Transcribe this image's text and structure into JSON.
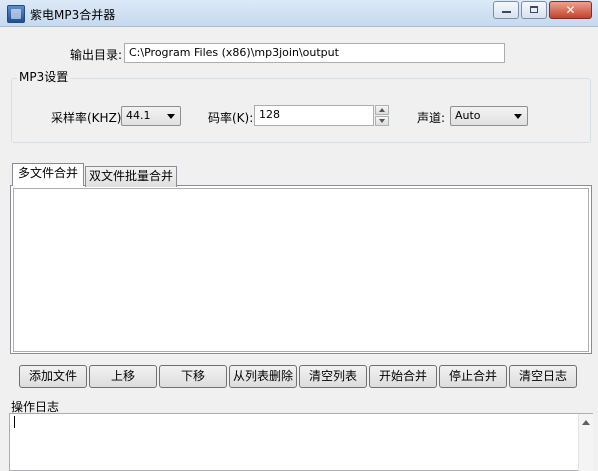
{
  "window": {
    "title": "紫电MP3合并器",
    "close_glyph": "✕"
  },
  "output": {
    "label": "输出目录:",
    "value": "C:\\Program Files (x86)\\mp3join\\output"
  },
  "mp3_settings": {
    "group_title": "MP3设置",
    "sample_rate_label": "采样率(KHZ):",
    "sample_rate_value": "44.1",
    "bitrate_label": "码率(K):",
    "bitrate_value": "128",
    "channel_label": "声道:",
    "channel_value": "Auto"
  },
  "tabs": [
    {
      "label": "多文件合并",
      "active": true
    },
    {
      "label": "双文件批量合并",
      "active": false
    }
  ],
  "buttons": {
    "add_file": "添加文件",
    "move_up": "上移",
    "move_down": "下移",
    "remove_from_list": "从列表删除",
    "clear_list": "清空列表",
    "start_merge": "开始合并",
    "stop_merge": "停止合并",
    "clear_log": "清空日志"
  },
  "log": {
    "label": "操作日志",
    "content": ""
  },
  "icons": {
    "app": "app-icon",
    "minimize": "minimize-icon",
    "maximize": "maximize-icon",
    "close": "close-icon",
    "combo_arrow": "chevron-down-icon",
    "spin_up": "spin-up-icon",
    "spin_down": "spin-down-icon",
    "scroll_up": "scroll-up-icon"
  }
}
